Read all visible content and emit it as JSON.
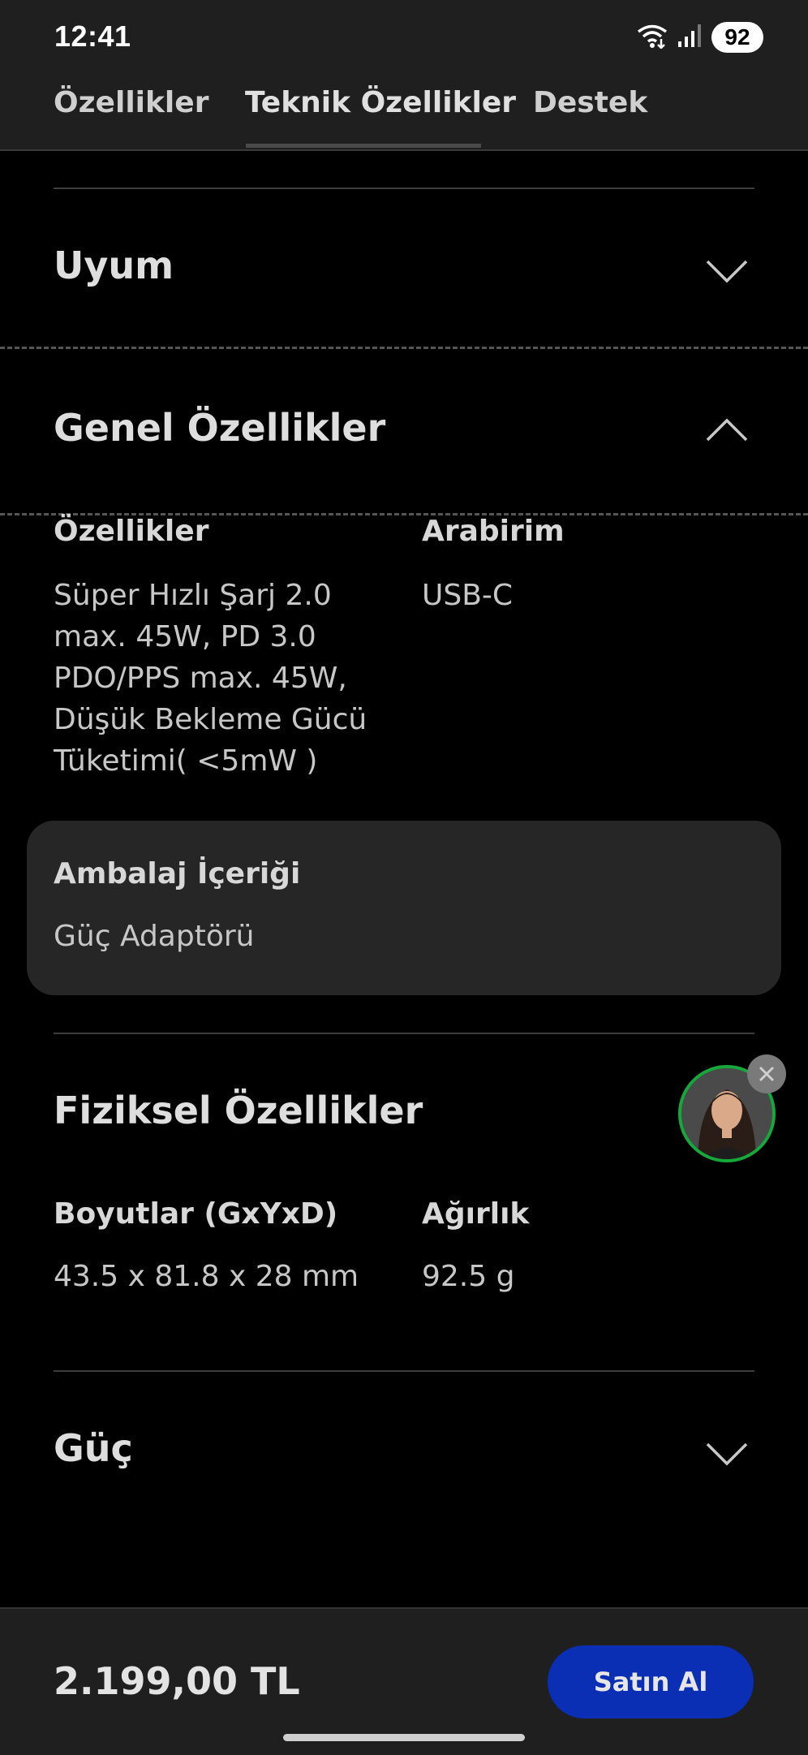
{
  "status_bar": {
    "time": "12:41",
    "battery": "92",
    "icons": [
      "wifi-icon",
      "signal-icon",
      "battery-icon"
    ]
  },
  "tabs": [
    {
      "label": "Özellikler"
    },
    {
      "label": "Teknik Özellikler",
      "active": true
    },
    {
      "label": "Destek"
    }
  ],
  "sections": {
    "uyum": {
      "title": "Uyum",
      "expanded": false
    },
    "genel": {
      "title": "Genel Özellikler",
      "expanded": true,
      "specs": [
        {
          "label": "Özellikler",
          "value": "Süper Hızlı Şarj 2.0 max. 45W, PD 3.0 PDO/PPS max. 45W, Düşük Bekleme Gücü Tüketimi( <5mW )"
        },
        {
          "label": "Arabirim",
          "value": "USB-C"
        }
      ],
      "package": {
        "label": "Ambalaj İçeriği",
        "value": "Güç Adaptörü"
      }
    },
    "fiziksel": {
      "title": "Fiziksel Özellikler",
      "specs": [
        {
          "label": "Boyutlar (GxYxD)",
          "value": "43.5 x 81.8 x 28 mm"
        },
        {
          "label": "Ağırlık",
          "value": "92.5 g"
        }
      ]
    },
    "guc": {
      "title": "Güç",
      "expanded": false
    }
  },
  "bottom_bar": {
    "price": "2.199,00 TL",
    "buy_label": "Satın Al"
  },
  "colors": {
    "background": "#000000",
    "bar": "#1f1f1f",
    "card": "#262626",
    "buy_button": "#0a2fb5",
    "avatar_ring": "#15a83a"
  }
}
